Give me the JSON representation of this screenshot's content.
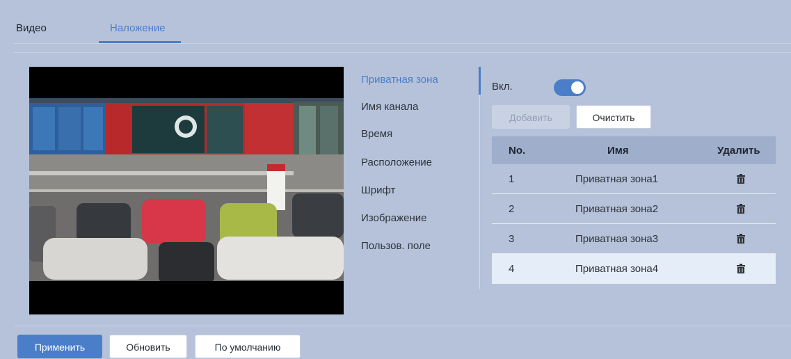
{
  "tabs": [
    {
      "label": "Видео"
    },
    {
      "label": "Наложение"
    }
  ],
  "menu": {
    "items": [
      {
        "label": "Приватная зона"
      },
      {
        "label": "Имя канала"
      },
      {
        "label": "Время"
      },
      {
        "label": "Расположение"
      },
      {
        "label": "Шрифт"
      },
      {
        "label": "Изображение"
      },
      {
        "label": "Пользов. поле"
      }
    ]
  },
  "privacy": {
    "enabled_label": "Вкл.",
    "enabled": true,
    "add_label": "Добавить",
    "clear_label": "Очистить"
  },
  "table": {
    "columns": [
      "No.",
      "Имя",
      "Удалить"
    ],
    "rows": [
      {
        "no": "1",
        "name": "Приватная зона1"
      },
      {
        "no": "2",
        "name": "Приватная зона2"
      },
      {
        "no": "3",
        "name": "Приватная зона3"
      },
      {
        "no": "4",
        "name": "Приватная зона4"
      }
    ]
  },
  "footer": {
    "apply_label": "Применить",
    "refresh_label": "Обновить",
    "default_label": "По умолчанию"
  },
  "colors": {
    "accent": "#4a7ec8",
    "background": "#b5c2da",
    "header_row": "#9eaecb",
    "selected_row": "#e4edf8"
  },
  "icons": {
    "delete": "trash-icon"
  }
}
